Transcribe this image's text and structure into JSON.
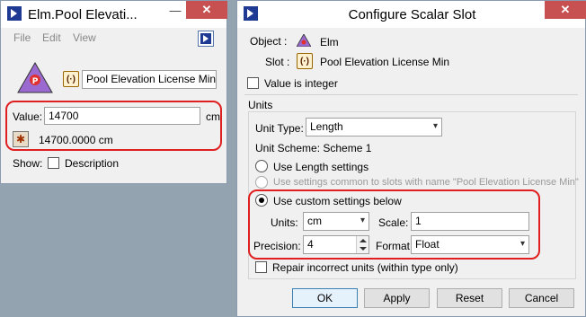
{
  "left_window": {
    "title": "Elm.Pool Elevati...",
    "menu": [
      "File",
      "Edit",
      "View"
    ],
    "slot_name": "Pool Elevation License Min",
    "value_label": "Value:",
    "value_input": "14700",
    "value_unit": "cm",
    "converted_value": "14700.0000 cm",
    "show_label": "Show:",
    "description_label": "Description"
  },
  "right_window": {
    "title": "Configure Scalar Slot",
    "object_label": "Object :",
    "object_value": "Elm",
    "slot_label": "Slot :",
    "slot_value": "Pool Elevation License Min",
    "value_is_integer": "Value is integer",
    "units_group": "Units",
    "unit_type_label": "Unit Type:",
    "unit_type_value": "Length",
    "unit_scheme": "Unit Scheme: Scheme 1",
    "radio_length": "Use Length settings",
    "radio_common": "Use settings common to slots with name \"Pool Elevation License Min\"",
    "radio_custom": "Use custom settings below",
    "units_label": "Units:",
    "units_value": "cm",
    "scale_label": "Scale:",
    "scale_value": "1",
    "precision_label": "Precision:",
    "precision_value": "4",
    "format_label": "Format",
    "format_value": "Float",
    "repair_label": "Repair incorrect units (within type only)",
    "buttons": {
      "ok": "OK",
      "apply": "Apply",
      "reset": "Reset",
      "cancel": "Cancel"
    }
  },
  "icons": {
    "app": "riverware-icon",
    "close": "close-icon",
    "minimize": "minimize-icon"
  },
  "colors": {
    "highlight": "#e02020",
    "close_button": "#c75050"
  }
}
